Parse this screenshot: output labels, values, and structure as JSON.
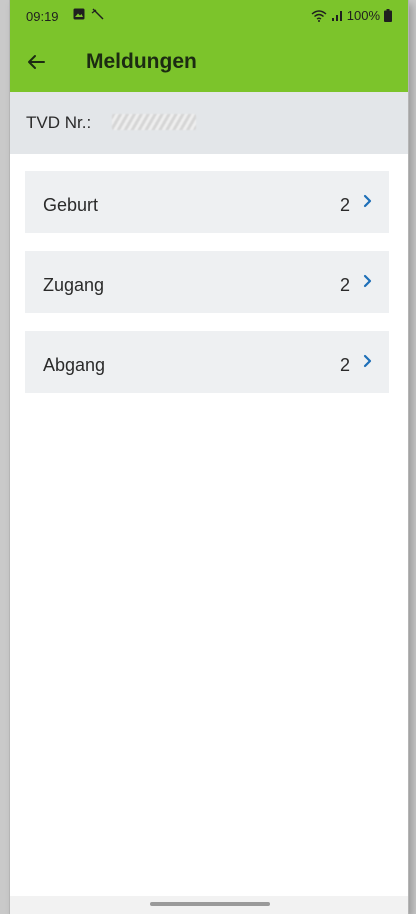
{
  "status_bar": {
    "time": "09:19",
    "battery": "100%",
    "icons": [
      "image-notification-icon",
      "signal-slash-icon",
      "wifi-icon",
      "cell-signal-icon",
      "battery-icon"
    ]
  },
  "app_bar": {
    "title": "Meldungen",
    "back_icon": "arrow-left-icon",
    "color": "#7cc42b"
  },
  "tvd": {
    "label": "TVD Nr.:",
    "value": ""
  },
  "list": {
    "items": [
      {
        "label": "Geburt",
        "count": "2"
      },
      {
        "label": "Zugang",
        "count": "2"
      },
      {
        "label": "Abgang",
        "count": "2"
      }
    ],
    "chevron_color": "#1e6fb8"
  }
}
